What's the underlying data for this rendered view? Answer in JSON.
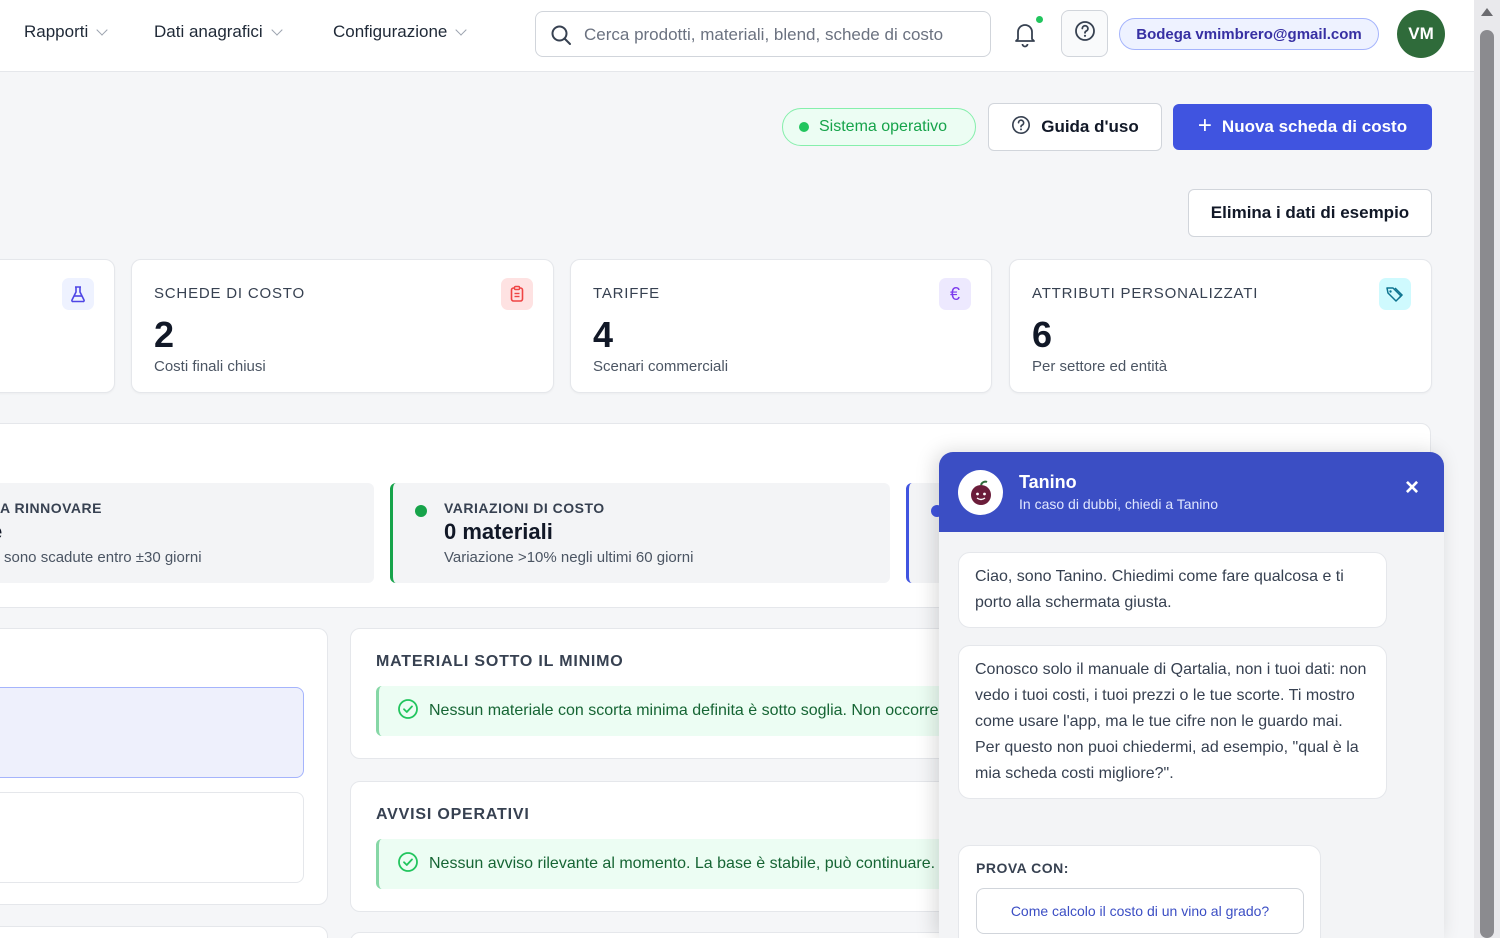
{
  "nav": {
    "items": [
      {
        "label": "Rapporti"
      },
      {
        "label": "Dati anagrafici"
      },
      {
        "label": "Configurazione"
      }
    ],
    "search_placeholder": "Cerca prodotti, materiali, blend, schede di costo",
    "user_label": "Bodega vmimbrero@gmail.com",
    "avatar_initials": "VM"
  },
  "header": {
    "status": "Sistema operativo",
    "guide_label": "Guida d'uso",
    "new_label": "Nuova scheda di costo",
    "delete_sample_label": "Elimina i dati di esempio"
  },
  "cards": [
    {
      "label": "Schede di costo",
      "value": "2",
      "sub": "Costi finali chiusi",
      "icon": "clipboard-icon",
      "color": "#ef4444"
    },
    {
      "label": "Tariffe",
      "value": "4",
      "sub": "Scenari commerciali",
      "icon": "euro-icon",
      "color": "#7c3aed"
    },
    {
      "label": "Attributi personalizzati",
      "value": "6",
      "sub": "Per settore ed entità",
      "icon": "tags-icon",
      "color": "#0e7490"
    }
  ],
  "alerts": [
    {
      "title": "A RINNOVARE",
      "value": "e",
      "sub": "sono scadute entro ±30 giorni"
    },
    {
      "title": "VARIAZIONI DI COSTO",
      "value": "0 materiali",
      "sub": "Variazione >10% negli ultimi 60 giorni"
    }
  ],
  "panels": {
    "min_title": "MATERIALI SOTTO IL MINIMO",
    "min_text": "Nessun materiale con scorta minima definita è sotto soglia. Non occorre riordinare.",
    "ops_title": "AVVISI OPERATIVI",
    "ops_text": "Nessun avviso rilevante al momento. La base è stabile, può continuare."
  },
  "chat": {
    "name": "Tanino",
    "subtitle": "In caso di dubbi, chiedi a Tanino",
    "msg1": "Ciao, sono Tanino. Chiedimi come fare qualcosa e ti porto alla schermata giusta.",
    "msg2": "Conosco solo il manuale di Qartalia, non i tuoi dati: non vedo i tuoi costi, i tuoi prezzi o le tue scorte. Ti mostro come usare l'app, ma le tue cifre non le guardo mai. Per questo non puoi chiedermi, ad esempio, \"qual è la mia scheda costi migliore?\".",
    "try_label": "PROVA CON:",
    "suggestion": "Come calcolo il costo di un vino al grado?"
  },
  "colors": {
    "primary": "#4054e0",
    "chat_header": "#3b4ec4",
    "success": "#22c55e",
    "avatar": "#2f6b3a"
  }
}
